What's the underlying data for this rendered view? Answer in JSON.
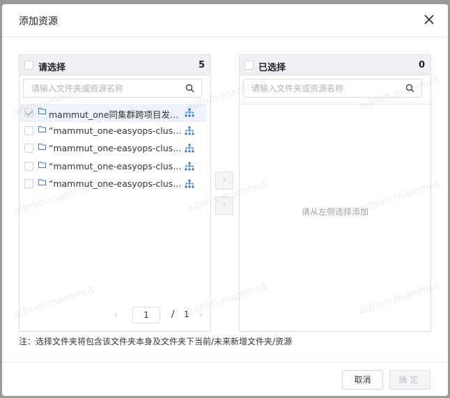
{
  "dialog": {
    "title": "添加资源",
    "close_icon": "close-icon"
  },
  "left_panel": {
    "title": "请选择",
    "count": "5",
    "search_placeholder": "请输入文件夹或资源名称",
    "items": [
      {
        "name": "mammut_one同集群跨项目发布测试",
        "checked": true,
        "disabled": true
      },
      {
        "name": "“mammut_one-easyops-cluster-demo”",
        "checked": false
      },
      {
        "name": "“mammut_one-easyops-cluster-demo”",
        "checked": false
      },
      {
        "name": "“mammut_one-easyops-cluster-demo”",
        "checked": false
      },
      {
        "name": "“mammut_one-easyops-cluster-demo”",
        "checked": false
      }
    ],
    "pager": {
      "current": "1",
      "separator": "/",
      "total": "1"
    }
  },
  "right_panel": {
    "title": "已选择",
    "count": "0",
    "search_placeholder": "请输入文件夹或资源名称",
    "empty_text": "请从左侧选择添加"
  },
  "transfer": {
    "to_right": "›",
    "to_left": "‹"
  },
  "note": "注：选择文件夹将包含该文件夹本身及文件夹下当前/未来新增文件夹/资源",
  "footer": {
    "cancel": "取消",
    "ok": "确定"
  },
  "watermark": "admin.mammut",
  "colors": {
    "folder": "#3a78d4",
    "tree": "#2f6fd0"
  }
}
